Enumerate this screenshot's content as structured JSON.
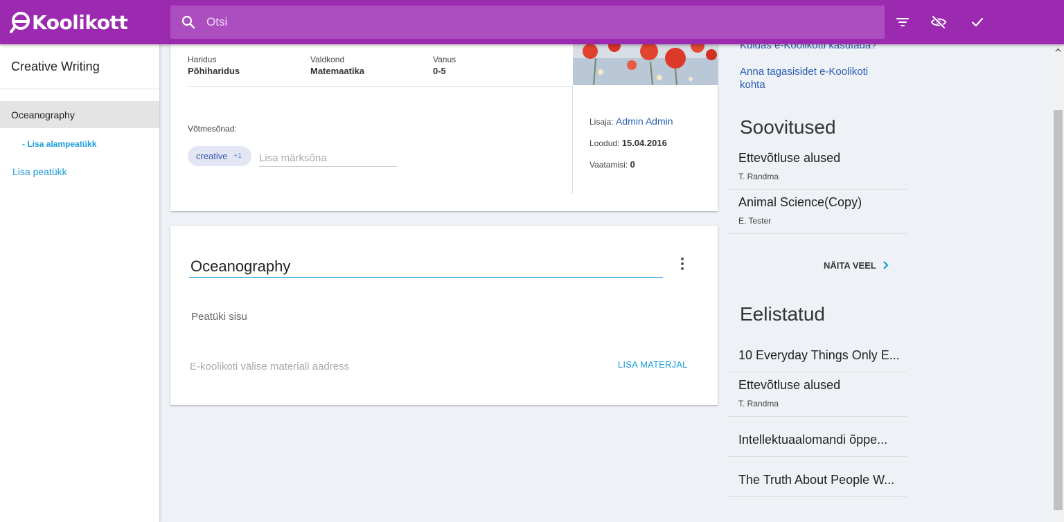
{
  "header": {
    "logo_text": "Koolikott",
    "search_placeholder": "Otsi",
    "icons": [
      "search-icon",
      "filter-icon",
      "visibility-off-icon",
      "check-icon"
    ]
  },
  "sidebar": {
    "title": "Creative Writing",
    "chapter": "Oceanography",
    "add_subchapter": "- Lisa alampeatükk",
    "add_chapter": "Lisa peatükk"
  },
  "material": {
    "education_label": "Haridus",
    "education_value": "Põhiharidus",
    "domain_label": "Valdkond",
    "domain_value": "Matemaatika",
    "age_label": "Vanus",
    "age_value": "0-5",
    "keywords_label": "Võtmesõnad:",
    "keyword_chip": "creative",
    "keyword_chip_count": "+1",
    "keyword_placeholder": "Lisa märksõna",
    "added_by_label": "Lisaja:",
    "added_by_value": "Admin Admin",
    "created_label": "Loodud:",
    "created_value": "15.04.2016",
    "views_label": "Vaatamisi:",
    "views_value": "0"
  },
  "chapter_card": {
    "title": "Oceanography",
    "content_placeholder": "Peatüki sisu",
    "url_placeholder": "E-koolikoti välise materiali aadress",
    "add_material_label": "LISA MATERJAL"
  },
  "right": {
    "link_howto": "Kuidas e-Koolikotti kasutada?",
    "link_feedback": "Anna tagasisidet e-Koolikoti kohta",
    "recommendations_heading": "Soovitused",
    "recommendations": [
      {
        "title": "Ettevõtluse alused",
        "author": "T. Randma"
      },
      {
        "title": "Animal Science(Copy)",
        "author": "E. Tester"
      }
    ],
    "show_more_label": "NÄITA VEEL",
    "featured_heading": "Eelistatud",
    "featured": [
      {
        "title": "10 Everyday Things Only E...",
        "author": ""
      },
      {
        "title": "Ettevõtluse alused",
        "author": "T. Randma"
      },
      {
        "title": "Intellektuaalomandi õppe...",
        "author": ""
      },
      {
        "title": "The Truth About People W...",
        "author": ""
      }
    ]
  },
  "colors": {
    "brand": "#9c2ab0",
    "link": "#2a5db0",
    "accent": "#1a9bd7"
  }
}
